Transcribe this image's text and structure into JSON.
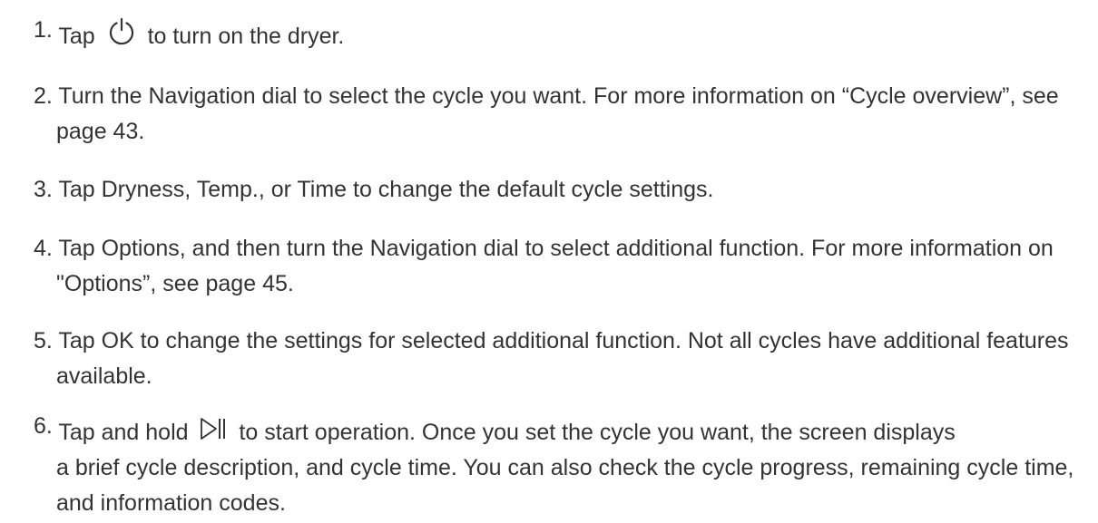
{
  "steps": [
    {
      "num": "1.",
      "before": "Tap ",
      "icon": "power-icon",
      "after": " to turn on the dryer."
    },
    {
      "num": "2.",
      "text": "Turn the Navigation dial to select the cycle you want. For more information on “Cycle overview”, see page 43."
    },
    {
      "num": "3.",
      "text": "Tap Dryness, Temp., or Time to change the default cycle settings."
    },
    {
      "num": "4.",
      "text": "Tap Options, and then turn the Navigation dial to select additional function. For more information on \"Options”, see page 45."
    },
    {
      "num": "5.",
      "text": "Tap OK to change the settings for selected additional function. Not all cycles have additional features available."
    },
    {
      "num": "6.",
      "before": "Tap and hold ",
      "icon": "play-pause-icon",
      "after": " to start operation. Once you set the cycle you want, the screen displays",
      "cont": "a brief cycle description, and cycle time. You can also check the cycle progress, remaining cycle time, and information codes."
    }
  ]
}
